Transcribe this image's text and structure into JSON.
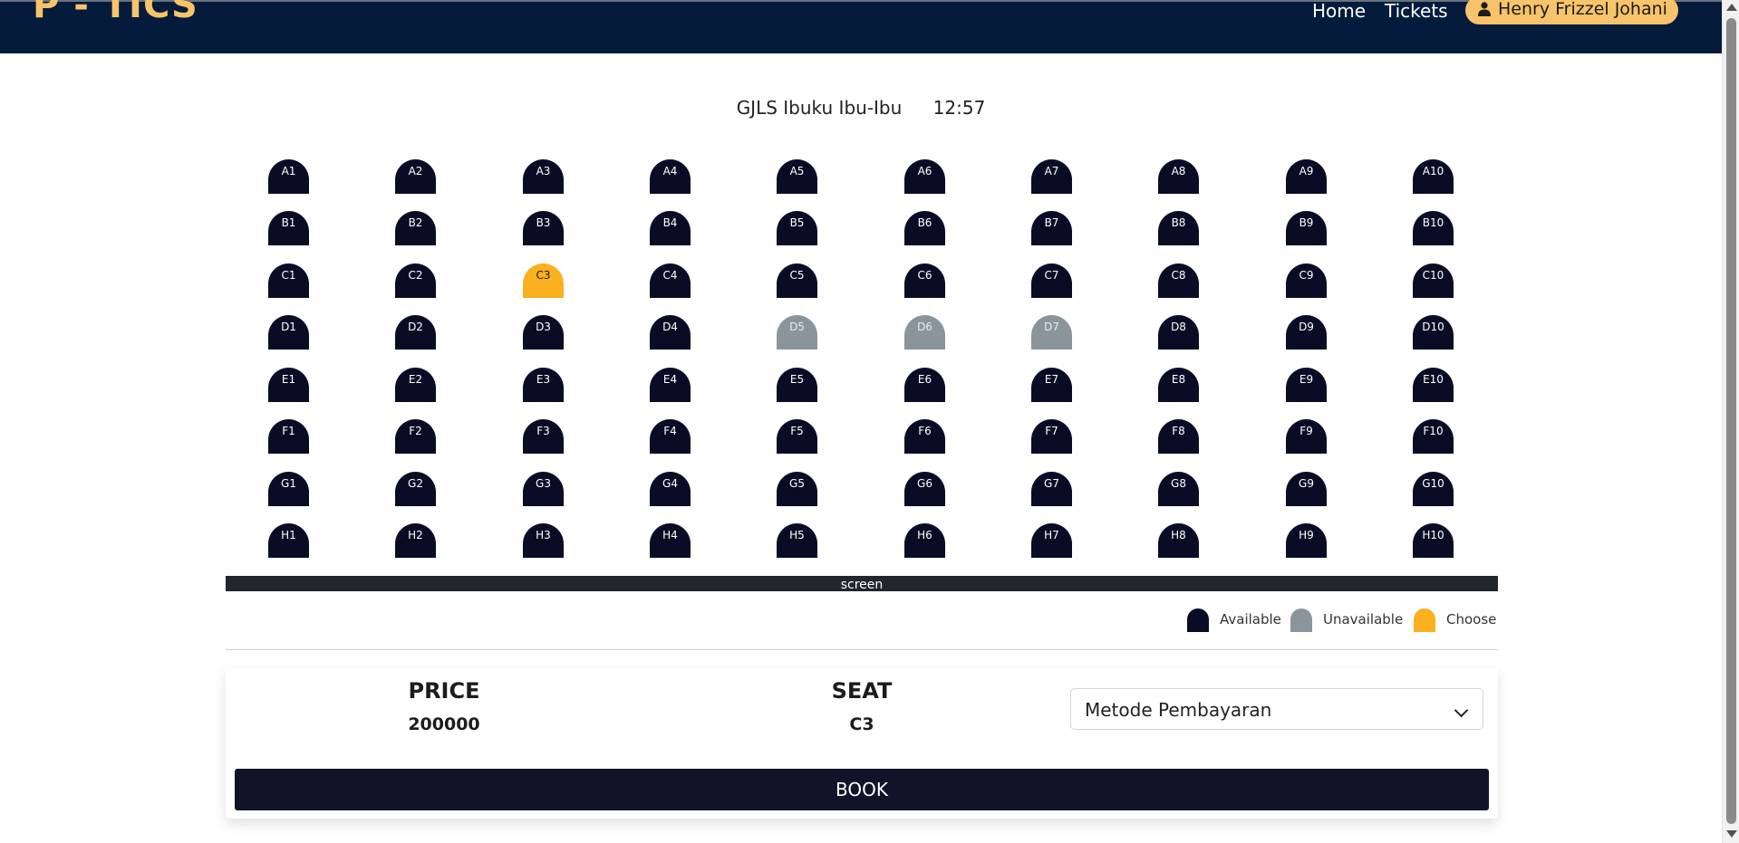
{
  "navbar": {
    "brand": "P - TICS",
    "links": {
      "home": "Home",
      "tickets": "Tickets"
    },
    "user": {
      "name": "Henry Frizzel Johani",
      "icon": "user-icon"
    },
    "background": "#051b3b",
    "accent": "#f7c46b"
  },
  "movie": {
    "title": "GJLS Ibuku Ibu-Ibu",
    "time": "12:57"
  },
  "seats": {
    "rows": [
      "A",
      "B",
      "C",
      "D",
      "E",
      "F",
      "G",
      "H"
    ],
    "columns": 10,
    "unavailable": [
      "D5",
      "D6",
      "D7"
    ],
    "selected": [
      "C3"
    ],
    "colors": {
      "available": "#0a0c26",
      "unavailable": "#8a959b",
      "choose": "#fbb01f"
    }
  },
  "screen": {
    "label": "screen"
  },
  "legend": {
    "available": "Available",
    "unavailable": "Unavailable",
    "choose": "Choose"
  },
  "booking": {
    "price_label": "PRICE",
    "price_value": "200000",
    "seat_label": "SEAT",
    "seat_value": "C3",
    "payment_placeholder": "Metode Pembayaran",
    "book_label": "BOOK"
  }
}
